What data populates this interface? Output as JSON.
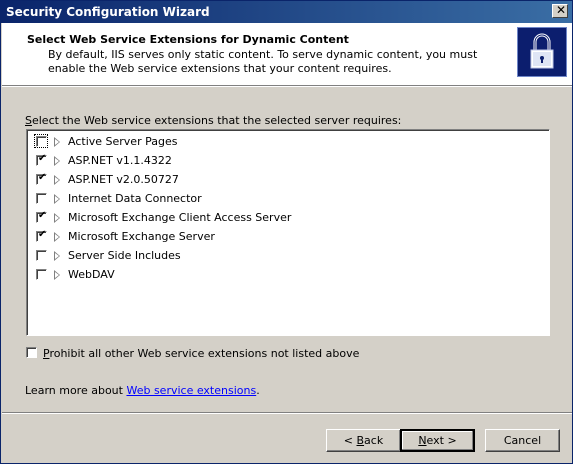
{
  "window": {
    "title": "Security Configuration Wizard",
    "close_glyph": "✕"
  },
  "header": {
    "title": "Select Web Service Extensions for Dynamic Content",
    "description": "By default, IIS serves only static content. To serve dynamic content, you must enable the Web service extensions that your content requires.",
    "icon": "padlock-icon"
  },
  "main": {
    "instruction_prefix": "S",
    "instruction_rest": "elect the Web service extensions that the selected server requires:",
    "extensions": [
      {
        "label": "Active Server Pages",
        "checked": false
      },
      {
        "label": "ASP.NET v1.1.4322",
        "checked": true
      },
      {
        "label": "ASP.NET v2.0.50727",
        "checked": true
      },
      {
        "label": "Internet Data Connector",
        "checked": false
      },
      {
        "label": "Microsoft Exchange Client Access Server",
        "checked": true
      },
      {
        "label": "Microsoft Exchange Server",
        "checked": true
      },
      {
        "label": "Server Side Includes",
        "checked": false
      },
      {
        "label": "WebDAV",
        "checked": false
      }
    ],
    "prohibit_prefix": "P",
    "prohibit_rest": "rohibit all other Web service extensions not listed above",
    "prohibit_checked": false,
    "learn_prefix": "Learn more about ",
    "learn_link": "Web service extensions",
    "learn_suffix": "."
  },
  "buttons": {
    "back_prefix": "< ",
    "back_key": "B",
    "back_rest": "ack",
    "next_key": "N",
    "next_rest": "ext >",
    "cancel": "Cancel"
  },
  "colors": {
    "title_bar": "#0a246a",
    "face": "#d4d0c8",
    "link": "#0000ff"
  }
}
